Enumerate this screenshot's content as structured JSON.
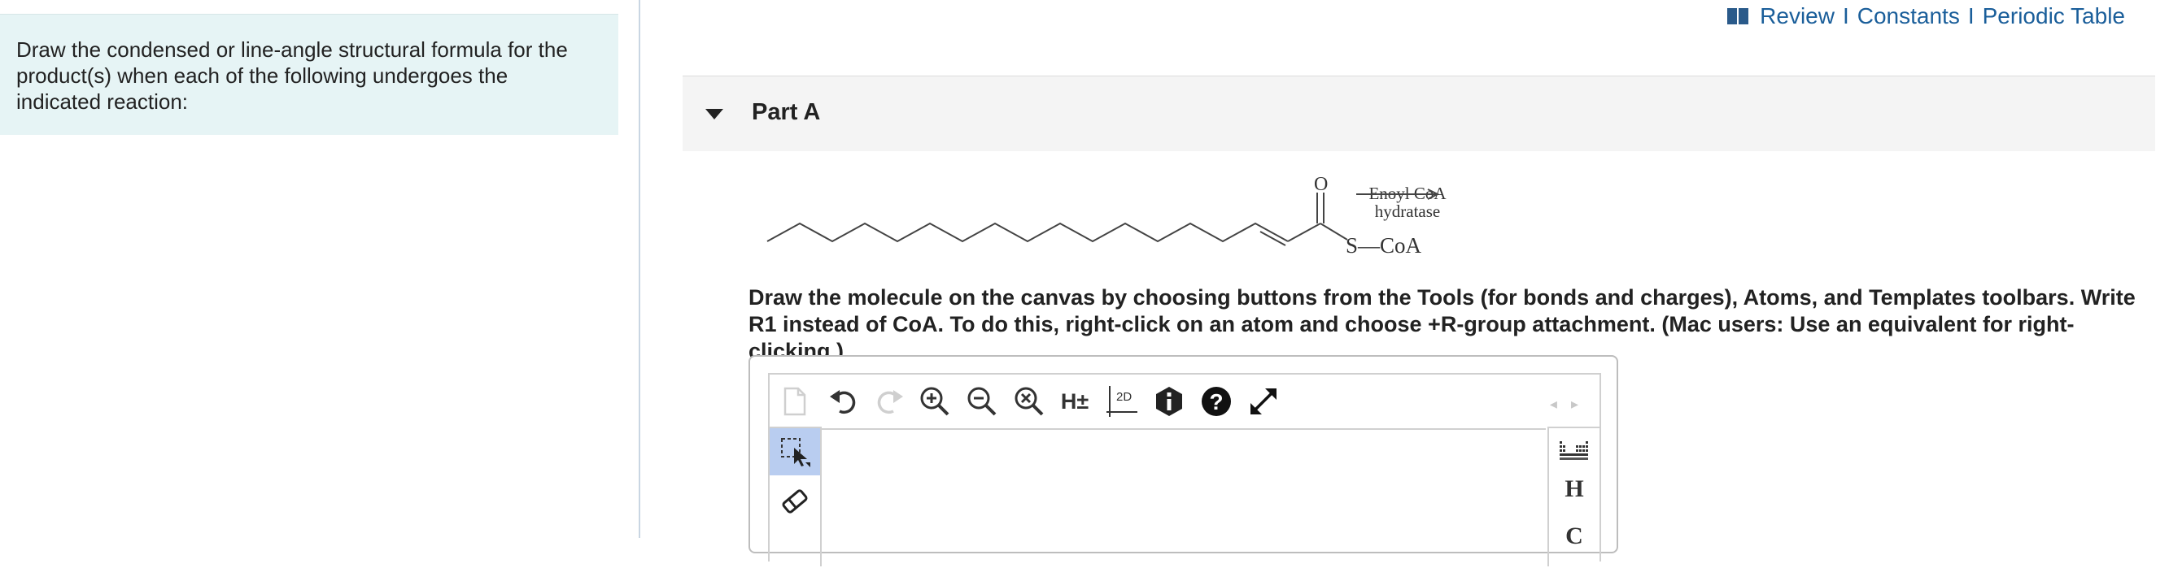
{
  "instructions": "Draw the condensed or line-angle structural formula for the product(s) when each of the following undergoes the indicated reaction:",
  "top_links": {
    "review": "Review",
    "constants": "Constants",
    "periodic_table": "Periodic Table",
    "separator": "I"
  },
  "part": {
    "title": "Part A"
  },
  "reaction": {
    "oxygen": "O",
    "sulfur_coa": "S—CoA",
    "enzyme_line1": "Enoyl CoA",
    "enzyme_line2": "hydratase"
  },
  "prompt": "Draw the molecule on the canvas by choosing buttons from the Tools (for bonds and charges), Atoms, and Templates toolbars. Write R1 instead of CoA. To do this, right-click on an atom and choose +R-group attachment. (Mac users: Use an equivalent for right-clicking.)",
  "editor": {
    "toolbar": {
      "h_toggle": "H±",
      "clean_2d": "2D"
    },
    "right_atoms": {
      "h": "H",
      "c": "C"
    }
  }
}
